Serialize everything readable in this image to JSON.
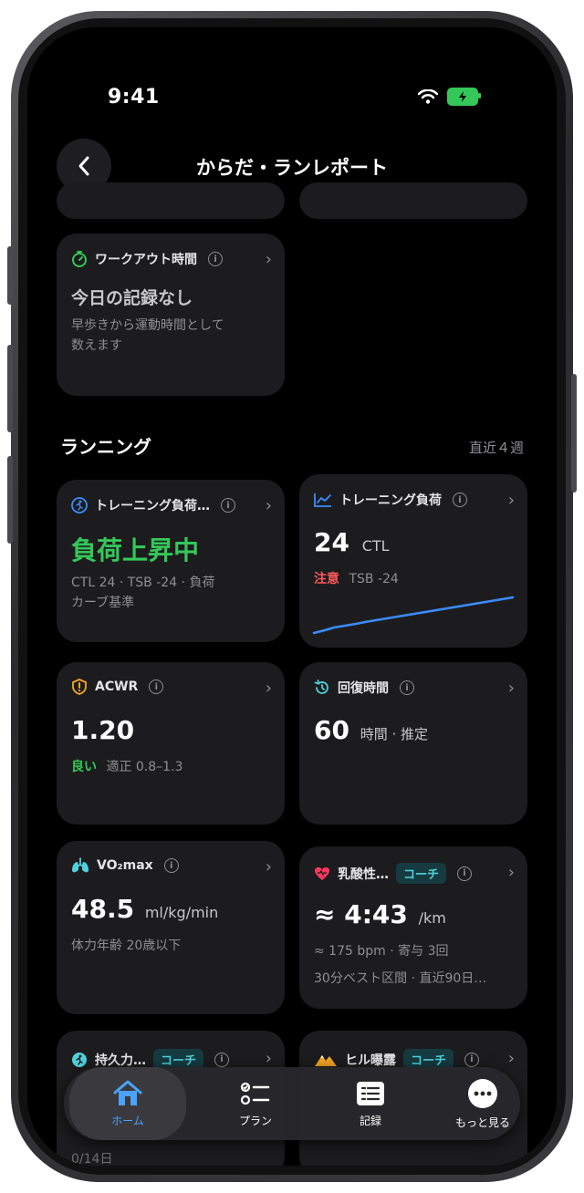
{
  "status": {
    "time": "9:41"
  },
  "nav": {
    "title": "からだ・ランレポート"
  },
  "workout": {
    "title": "ワークアウト時間",
    "value": "今日の記録なし",
    "desc_line1": "早歩きから運動時間として",
    "desc_line2": "数えます"
  },
  "section": {
    "title": "ランニング",
    "range": "直近４週"
  },
  "training_load_status": {
    "title": "トレーニング負荷…",
    "value": "負荷上昇中",
    "desc_line1": "CTL 24 · TSB -24 · 負荷",
    "desc_line2": "カーブ基準",
    "value_color": "#34c759"
  },
  "training_load": {
    "title": "トレーニング負荷",
    "value": "24",
    "unit": "CTL",
    "warn": "注意",
    "tsb": "TSB -24",
    "line_color": "#3b8cff"
  },
  "acwr": {
    "title": "ACWR",
    "value": "1.20",
    "status": "良い",
    "desc": "適正 0.8–1.3"
  },
  "recovery": {
    "title": "回復時間",
    "value": "60",
    "unit": "時間 · 推定"
  },
  "vo2": {
    "title": "VO₂max",
    "value": "48.5",
    "unit": "ml/kg/min",
    "desc": "体力年齢 20歳以下"
  },
  "lactate": {
    "title": "乳酸性…",
    "badge": "コーチ",
    "value": "≈ 4:43",
    "unit": "/km",
    "desc_line1": "≈ 175 bpm · 寄与 3回",
    "desc_line2": "30分ベスト区間 · 直近90日…"
  },
  "endurance": {
    "title": "持久力…",
    "badge": "コーチ",
    "footnote": "0/14日"
  },
  "hill": {
    "title": "ヒル曝露",
    "badge": "コーチ"
  },
  "tabs": [
    {
      "label": "ホーム"
    },
    {
      "label": "プラン"
    },
    {
      "label": "記録"
    },
    {
      "label": "もっと見る"
    }
  ]
}
